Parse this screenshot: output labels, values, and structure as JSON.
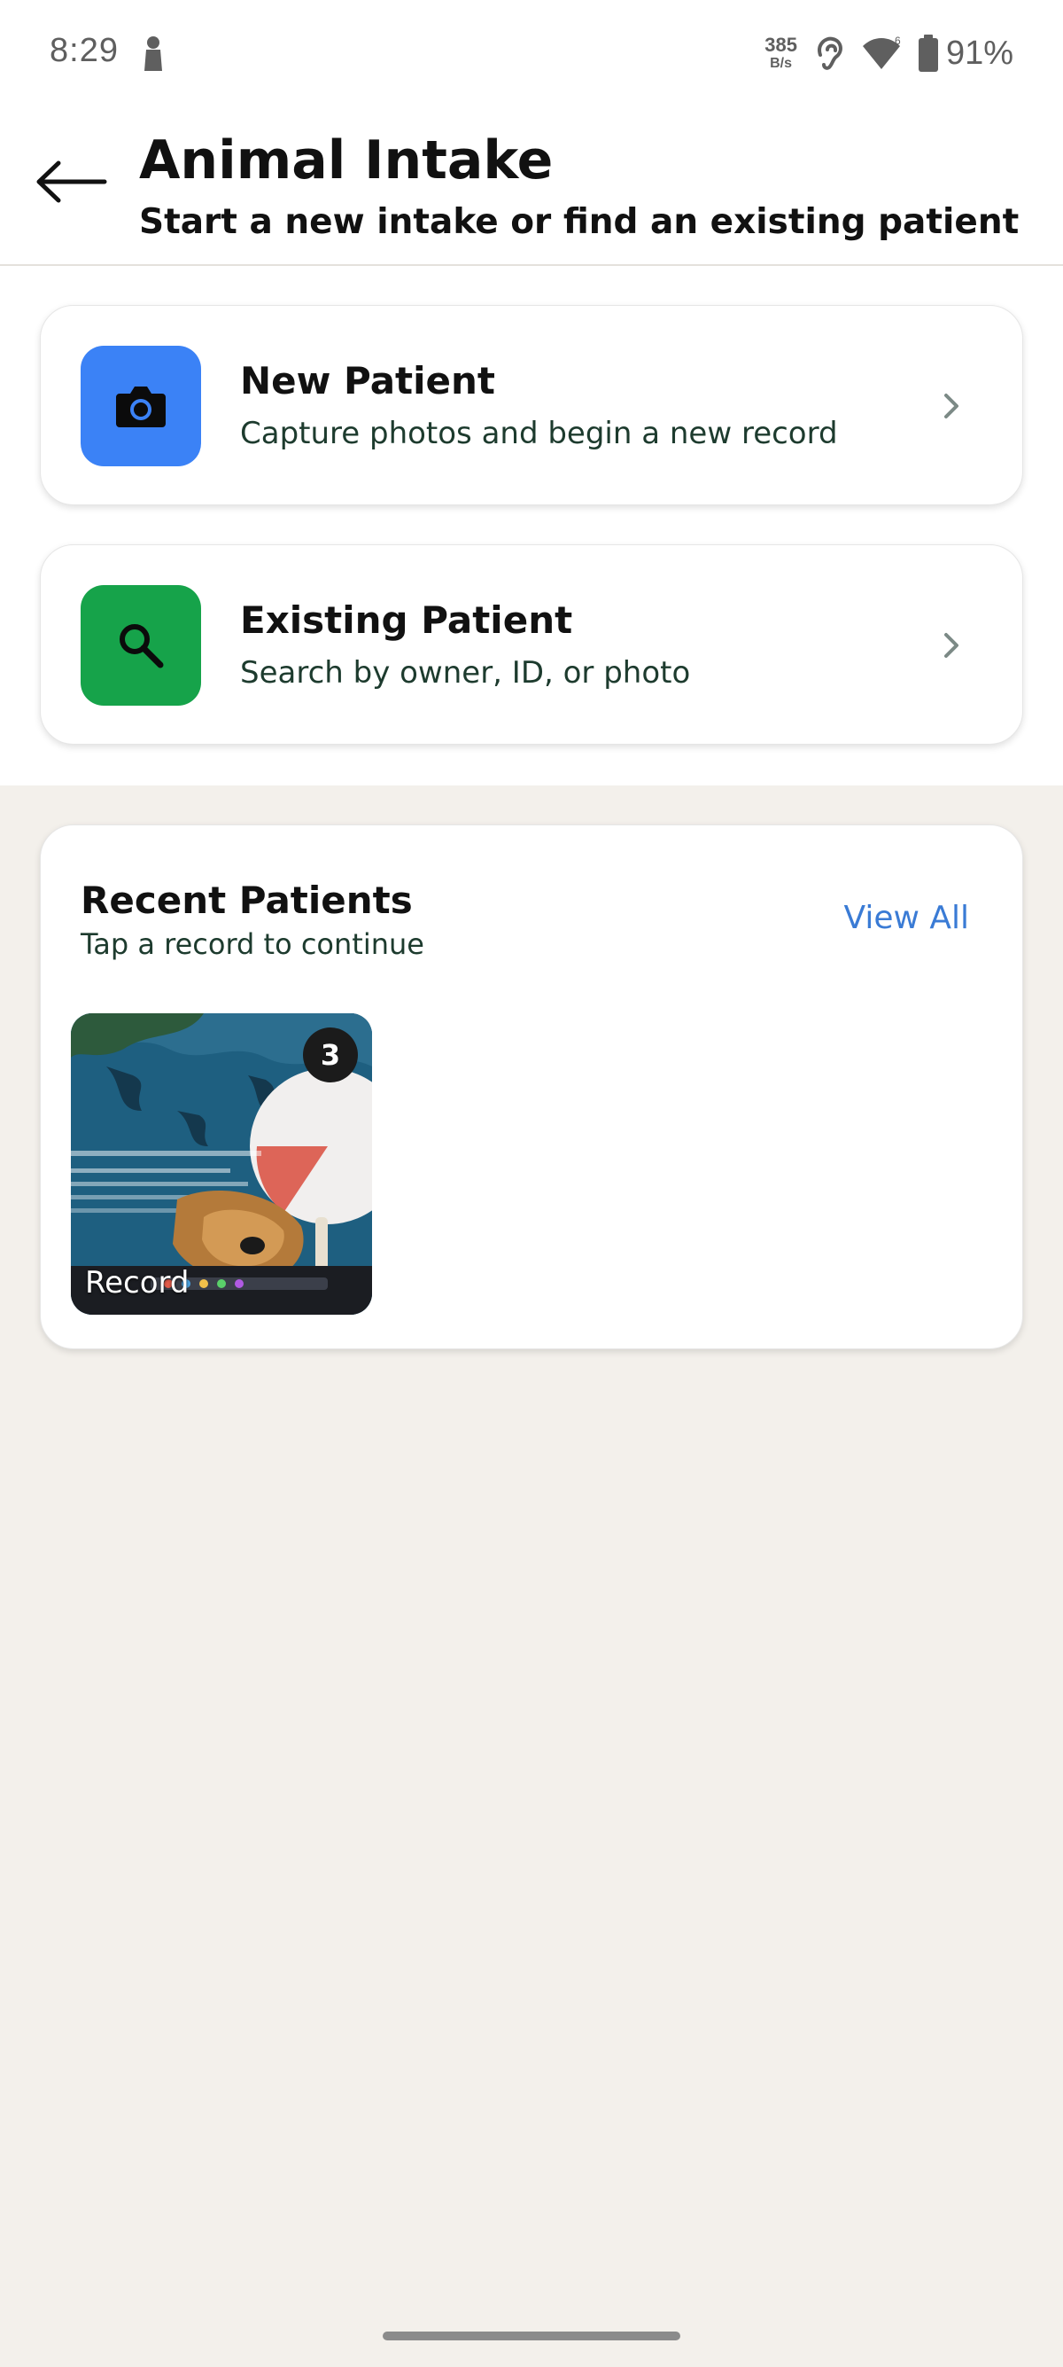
{
  "status_bar": {
    "time": "8:29",
    "net_speed_value": "385",
    "net_speed_unit": "B/s",
    "battery": "91%",
    "icons": [
      "person-icon",
      "hearing-icon",
      "wifi-icon",
      "battery-icon"
    ]
  },
  "header": {
    "title": "Animal Intake",
    "subtitle": "Start a new intake or find an existing patient",
    "back_icon": "arrow-left-icon"
  },
  "actions": [
    {
      "title": "New Patient",
      "description": "Capture photos and begin a new record",
      "icon": "camera-icon",
      "color": "#3b82f6"
    },
    {
      "title": "Existing Patient",
      "description": "Search by owner, ID, or photo",
      "icon": "search-icon",
      "color": "#16a34a"
    }
  ],
  "recent": {
    "title": "Recent Patients",
    "subtitle": "Tap a record to continue",
    "view_all": "View All",
    "records": [
      {
        "label": "Record",
        "photo_count": "3"
      }
    ]
  },
  "colors": {
    "background": "#f3f0eb",
    "accent_link": "#3a7bd5",
    "desc_text": "#1d3b2e"
  }
}
